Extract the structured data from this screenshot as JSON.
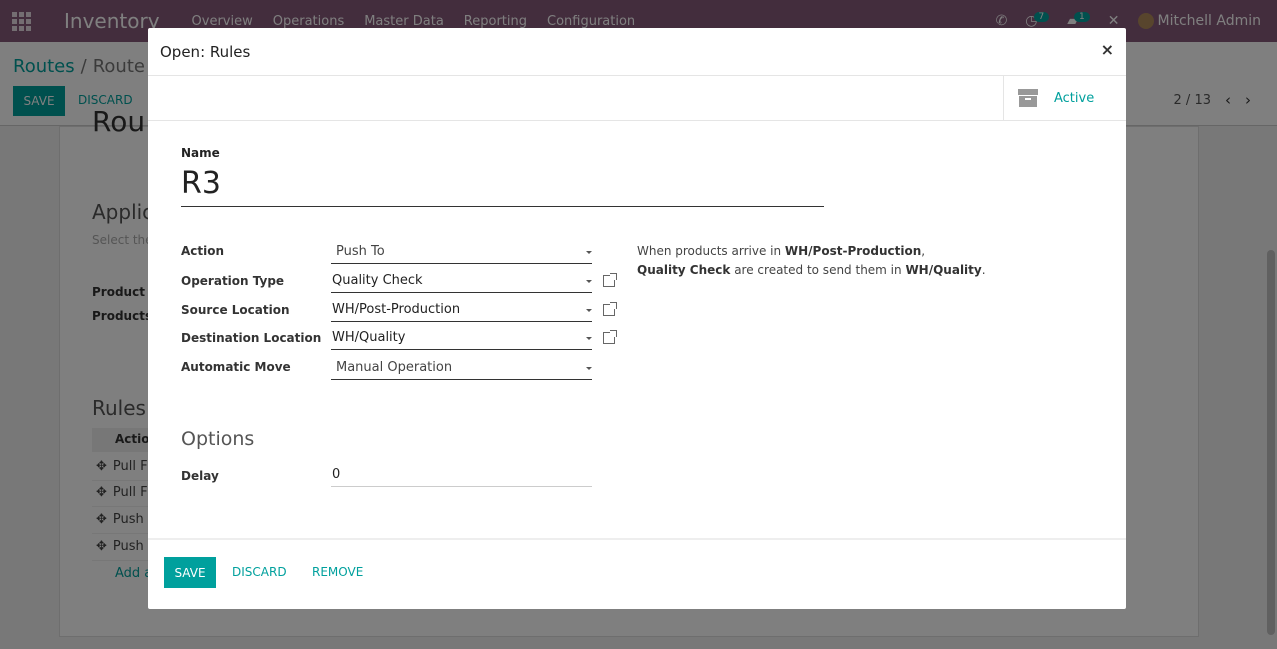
{
  "navbar": {
    "app_name": "Inventory",
    "menu": [
      "Overview",
      "Operations",
      "Master Data",
      "Reporting",
      "Configuration"
    ],
    "activity_count": "7",
    "message_count": "1",
    "user": "Mitchell Admin"
  },
  "control_panel": {
    "breadcrumb_parent": "Routes",
    "breadcrumb_sep": "/",
    "breadcrumb_current": "Route",
    "save_label": "SAVE",
    "discard_label": "DISCARD",
    "pager": "2 / 13"
  },
  "background_form": {
    "title_fragment": "Rou",
    "applicability_fragment": "Applica",
    "applicability_help_fragment": "Select the",
    "product_categories_fragment": "Product C",
    "products_fragment": "Products",
    "rules_heading": "Rules",
    "rules_col_action": "Action",
    "rules_rows": [
      "Pull F",
      "Pull F",
      "Push",
      "Push"
    ],
    "add_line_fragment": "Add a"
  },
  "modal": {
    "title": "Open: Rules",
    "close_glyph": "×",
    "active_label": "Active",
    "name_label": "Name",
    "name_value": "R3",
    "fields": {
      "action": {
        "label": "Action",
        "value": "Push To"
      },
      "operation_type": {
        "label": "Operation Type",
        "value": "Quality Check"
      },
      "source_location": {
        "label": "Source Location",
        "value": "WH/Post-Production"
      },
      "destination_location": {
        "label": "Destination Location",
        "value": "WH/Quality"
      },
      "automatic_move": {
        "label": "Automatic Move",
        "value": "Manual Operation"
      }
    },
    "help": {
      "line1_prefix": "When products arrive in ",
      "line1_location": "WH/Post-Production",
      "line1_suffix": ",",
      "line2_type": "Quality Check",
      "line2_mid": " are created to send them in ",
      "line2_location": "WH/Quality",
      "line2_suffix": "."
    },
    "options_title": "Options",
    "delay": {
      "label": "Delay",
      "value": "0"
    },
    "footer": {
      "save_label": "SAVE",
      "discard_label": "DISCARD",
      "remove_label": "REMOVE"
    }
  }
}
